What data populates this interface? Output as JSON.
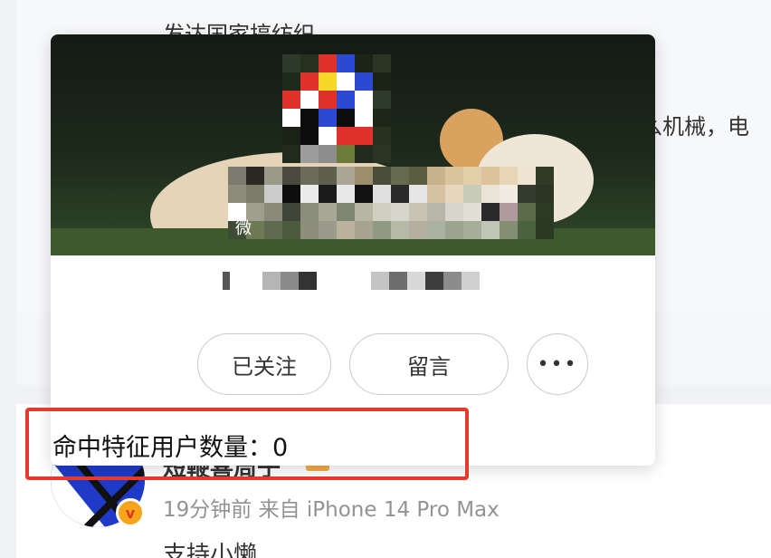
{
  "feed": {
    "top_text": "发达国家搞纺织，",
    "side_text": "么机械，电",
    "post": {
      "username": "短鞭喜周子",
      "meta": "19分钟前 来自 iPhone 14 Pro Max",
      "body": "支持小懒"
    }
  },
  "profile_card": {
    "cover_tag": "微",
    "follow_label": "已关注",
    "message_label": "留言",
    "more_label": "•••"
  },
  "annotation": {
    "label": "命中特征用户数量：",
    "count": "0"
  },
  "colors": {
    "annotation_border": "#e23b2e",
    "button_border": "#c9c9c9",
    "verify_badge": "#f7a51b"
  },
  "icons": {
    "more": "more-dots-icon",
    "verify": "verified-v-icon"
  }
}
